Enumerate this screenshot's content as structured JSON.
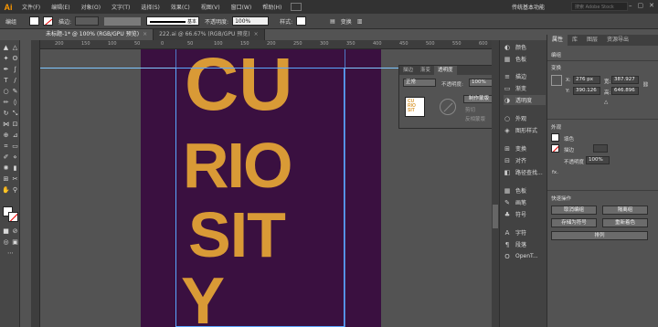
{
  "app": {
    "logo": "Ai",
    "workspace": "传统基本功能",
    "search_placeholder": "搜索 Adobe Stock"
  },
  "menu": [
    "文件(F)",
    "编辑(E)",
    "对象(O)",
    "文字(T)",
    "选择(S)",
    "效果(C)",
    "视图(V)",
    "窗口(W)",
    "帮助(H)"
  ],
  "control": {
    "object": "编组",
    "stroke_label": "描边:",
    "stroke_style": "基本",
    "opacity_label": "不透明度:",
    "opacity_value": "100%",
    "style_label": "样式:",
    "transform": "变换"
  },
  "tabs": [
    {
      "title": "未标题-1* @ 100% (RGB/GPU 预览)",
      "close": "×"
    },
    {
      "title": "222.ai @ 66.67% (RGB/GPU 预览)",
      "close": "×"
    }
  ],
  "ruler": [
    "200",
    "150",
    "100",
    "50",
    "0",
    "50",
    "100",
    "150",
    "200",
    "250",
    "300",
    "350",
    "400",
    "450",
    "500",
    "550",
    "600"
  ],
  "artwork": {
    "rows": [
      "CU",
      "RIO",
      "SIT",
      "Y"
    ],
    "color": "#d99a36",
    "bg": "#3a1040"
  },
  "transparency_panel": {
    "tabs": [
      "描边",
      "渐变",
      "透明度"
    ],
    "blend_mode": "正常",
    "opacity_label": "不透明度:",
    "opacity_value": "100%",
    "make_mask": "制作蒙版",
    "clip": "剪切",
    "invert_mask": "反相蒙版"
  },
  "dock": [
    {
      "icon": "color-icon",
      "glyph": "◐",
      "label": "颜色"
    },
    {
      "icon": "swatches-icon",
      "glyph": "▦",
      "label": "色板"
    },
    {
      "icon": "stroke-icon",
      "glyph": "≡",
      "label": "描边"
    },
    {
      "icon": "gradient-icon",
      "glyph": "▭",
      "label": "渐变"
    },
    {
      "icon": "transparency-icon",
      "glyph": "◑",
      "label": "透明度"
    },
    {
      "icon": "appearance-icon",
      "glyph": "○",
      "label": "外观"
    },
    {
      "icon": "graphic-styles-icon",
      "glyph": "◈",
      "label": "图形样式"
    },
    {
      "icon": "transform-icon",
      "glyph": "⊞",
      "label": "变换"
    },
    {
      "icon": "align-icon",
      "glyph": "⊟",
      "label": "对齐"
    },
    {
      "icon": "pathfinder-icon",
      "glyph": "◧",
      "label": "路径查找..."
    },
    {
      "icon": "swatch-libs-icon",
      "glyph": "▦",
      "label": "色板"
    },
    {
      "icon": "brushes-icon",
      "glyph": "✎",
      "label": "画笔"
    },
    {
      "icon": "symbols-icon",
      "glyph": "♣",
      "label": "符号"
    },
    {
      "icon": "character-icon",
      "glyph": "A",
      "label": "字符"
    },
    {
      "icon": "paragraph-icon",
      "glyph": "¶",
      "label": "段落"
    },
    {
      "icon": "opentype-icon",
      "glyph": "O",
      "label": "OpenT..."
    }
  ],
  "properties": {
    "tabs": [
      "属性",
      "库",
      "图层",
      "资源导出"
    ],
    "object": "编组",
    "transform_title": "变换",
    "x_label": "X:",
    "x": "276 px",
    "y_label": "Y:",
    "y": "390.126",
    "w_label": "宽:",
    "w": "387.927",
    "h_label": "高:",
    "h": "646.896",
    "appearance_title": "外观",
    "fill_label": "填色",
    "stroke_label": "描边",
    "opacity_label": "不透明度",
    "opacity_value": "100%",
    "fx": "fx.",
    "quick_title": "快速操作",
    "btn_ungroup": "取消编组",
    "btn_isolate": "隔离组",
    "btn_save_symbol": "存储为符号",
    "btn_recolor": "重新着色",
    "btn_arrange": "排列"
  }
}
